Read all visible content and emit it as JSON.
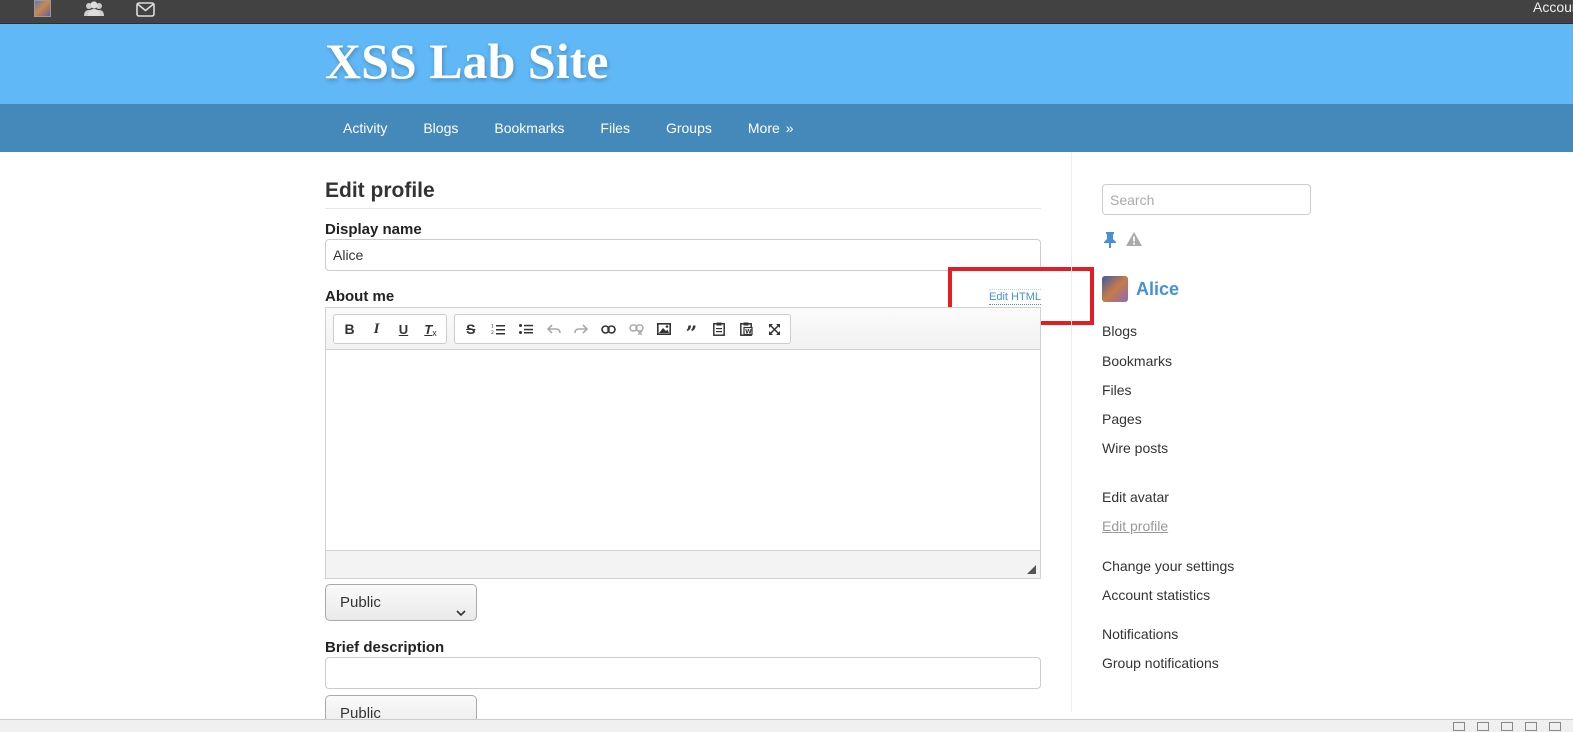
{
  "topbar": {
    "account_label": "Account"
  },
  "header": {
    "site_title": "XSS Lab Site"
  },
  "nav": {
    "items": [
      "Activity",
      "Blogs",
      "Bookmarks",
      "Files",
      "Groups"
    ],
    "more_label": "More",
    "more_suffix": "»"
  },
  "form": {
    "page_title": "Edit profile",
    "display_name_label": "Display name",
    "display_name_value": "Alice",
    "about_me_label": "About me",
    "edit_html_label": "Edit HTML",
    "about_access": "Public",
    "brief_label": "Brief description",
    "brief_value": "",
    "brief_access": "Public"
  },
  "editor_tools": {
    "group1": [
      "bold-icon",
      "italic-icon",
      "underline-icon",
      "remove-format-icon"
    ],
    "group2": [
      "strikethrough-icon",
      "numbered-list-icon",
      "bulleted-list-icon",
      "undo-icon",
      "redo-icon",
      "link-icon",
      "unlink-icon",
      "image-icon",
      "blockquote-icon",
      "paste-text-icon",
      "paste-word-icon",
      "maximize-icon"
    ]
  },
  "sidebar": {
    "search_placeholder": "Search",
    "owner_name": "Alice",
    "links_group1": [
      "Blogs",
      "Bookmarks",
      "Files",
      "Pages",
      "Wire posts"
    ],
    "links_group2": [
      "Edit avatar",
      "Edit profile"
    ],
    "links_group3": [
      "Change your settings",
      "Account statistics"
    ],
    "links_group4": [
      "Notifications",
      "Group notifications"
    ]
  },
  "colors": {
    "header_bg": "#60b8f7",
    "nav_bg": "#4588ba",
    "link": "#4690d6",
    "highlight": "#e21d24"
  }
}
